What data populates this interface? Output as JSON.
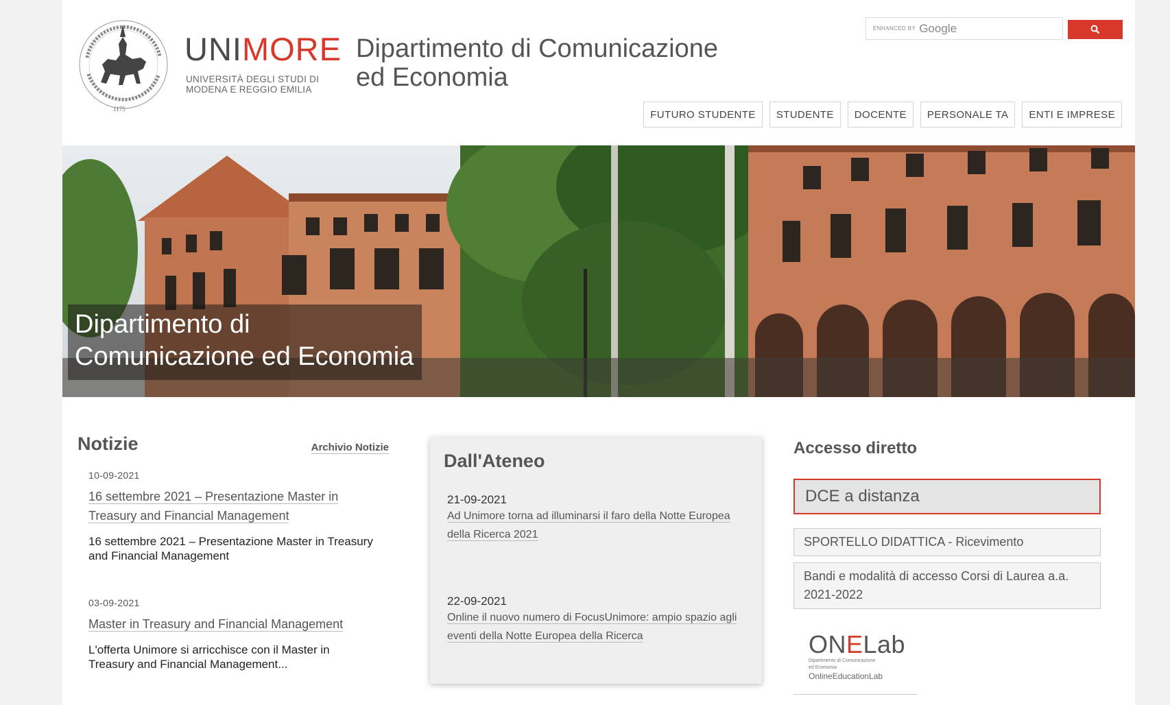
{
  "brand": {
    "word_part1": "UNI",
    "word_part2": "MORE",
    "sub_line1": "UNIVERSITÀ DEGLI STUDI DI",
    "sub_line2": "MODENA E REGGIO EMILIA",
    "seal_year": "1175"
  },
  "dept_title_line1": "Dipartimento di Comunicazione",
  "dept_title_line2": "ed Economia",
  "search": {
    "enhanced_by": "enhanced by",
    "brand": "Google",
    "button_icon": "search-icon"
  },
  "nav": [
    "FUTURO STUDENTE",
    "STUDENTE",
    "DOCENTE",
    "PERSONALE TA",
    "ENTI E IMPRESE"
  ],
  "hero": {
    "caption_line1": "Dipartimento di",
    "caption_line2": "Comunicazione ed Economia"
  },
  "news": {
    "heading": "Notizie",
    "archive_link": "Archivio Notizie",
    "items": [
      {
        "date": "10-09-2021",
        "title": "16 settembre 2021 – Presentazione Master in Treasury and Financial Management",
        "abstract": "16 settembre 2021 – Presentazione Master in Treasury and Financial Management"
      },
      {
        "date": "03-09-2021",
        "title": "Master in Treasury and Financial Management",
        "abstract": "L'offerta Unimore si arricchisce con il Master in Treasury and Financial Management..."
      }
    ]
  },
  "ateneo": {
    "heading": "Dall'Ateneo",
    "items": [
      {
        "date": "21-09-2021",
        "title": "Ad Unimore torna ad illuminarsi il faro della Notte Europea della Ricerca 2021"
      },
      {
        "date": "22-09-2021",
        "title": "Online il nuovo numero di FocusUnimore: ampio spazio agli eventi della Notte Europea della Ricerca"
      }
    ]
  },
  "access": {
    "heading": "Accesso diretto",
    "primary": "DCE a distanza",
    "links": [
      "SPORTELLO DIDATTICA - Ricevimento",
      "Bandi e modalità di accesso Corsi di Laurea a.a. 2021-2022"
    ],
    "onelab": {
      "mark_part1": "ON",
      "mark_part2": "E",
      "mark_part3": "Lab",
      "tiny_line1": "Dipartimento di Comunicazione",
      "tiny_line2": "ed Economia",
      "sub": "OnlineEducationLab"
    }
  },
  "colors": {
    "accent": "#d8382a",
    "text": "#555555",
    "page_bg": "#f2f2f2"
  }
}
